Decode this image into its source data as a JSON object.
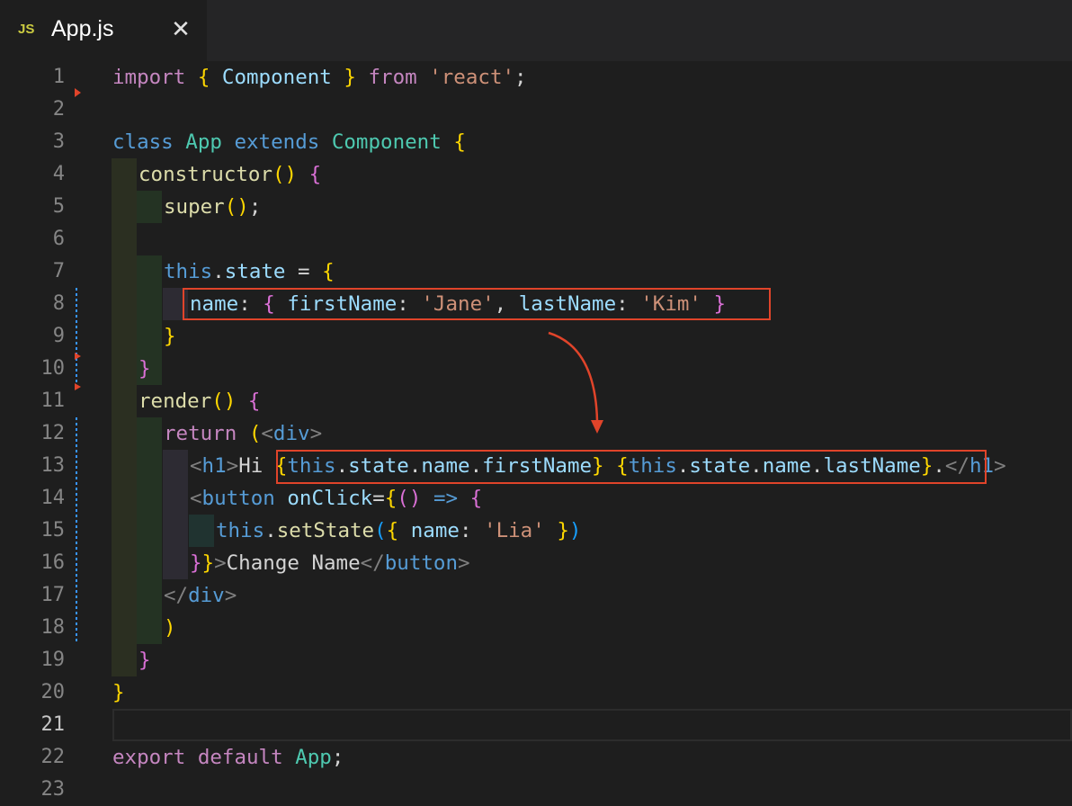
{
  "tab": {
    "icon": "JS",
    "title": "App.js",
    "close": "✕"
  },
  "line_numbers": [
    "1",
    "2",
    "3",
    "4",
    "5",
    "6",
    "7",
    "8",
    "9",
    "10",
    "11",
    "12",
    "13",
    "14",
    "15",
    "16",
    "17",
    "18",
    "19",
    "20",
    "21",
    "22",
    "23"
  ],
  "active_line": "21",
  "code": {
    "l1": [
      "import",
      "{",
      "Component",
      "}",
      "from",
      "'react'",
      ";"
    ],
    "l3": [
      "class",
      "App",
      "extends",
      "Component",
      "{"
    ],
    "l4": [
      "constructor",
      "()",
      "{"
    ],
    "l5": [
      "super",
      "()",
      ";"
    ],
    "l7": [
      "this",
      ".",
      "state",
      "=",
      "{"
    ],
    "l8": [
      "name",
      ":",
      "{",
      "firstName",
      ":",
      "'Jane'",
      ",",
      "lastName",
      ":",
      "'Kim'",
      "}"
    ],
    "l9": [
      "}"
    ],
    "l10": [
      "}"
    ],
    "l11": [
      "render",
      "()",
      "{"
    ],
    "l12": [
      "return",
      "(",
      "<",
      "div",
      ">"
    ],
    "l13": [
      "<",
      "h1",
      ">",
      "Hi ",
      "{",
      "this",
      ".",
      "state",
      ".",
      "name",
      ".",
      "firstName",
      "}",
      "{",
      "this",
      ".",
      "state",
      ".",
      "name",
      ".",
      "lastName",
      "}",
      ".",
      "</",
      "h1",
      ">"
    ],
    "l14": [
      "<",
      "button",
      "onClick",
      "=",
      "{",
      "()",
      "=>",
      "{"
    ],
    "l15": [
      "this",
      ".",
      "setState",
      "(",
      "{",
      "name",
      ":",
      "'Lia'",
      "}",
      ")"
    ],
    "l16": [
      "}",
      "}",
      ">",
      "Change Name",
      "</",
      "button",
      ">"
    ],
    "l17": [
      "</",
      "div",
      ">"
    ],
    "l18": [
      ")"
    ],
    "l19": [
      "}"
    ],
    "l20": [
      "}"
    ],
    "l22": [
      "export",
      "default",
      "App",
      ";"
    ]
  },
  "colors": {
    "highlight_box": "#e0442a",
    "arrow": "#e0442a"
  }
}
